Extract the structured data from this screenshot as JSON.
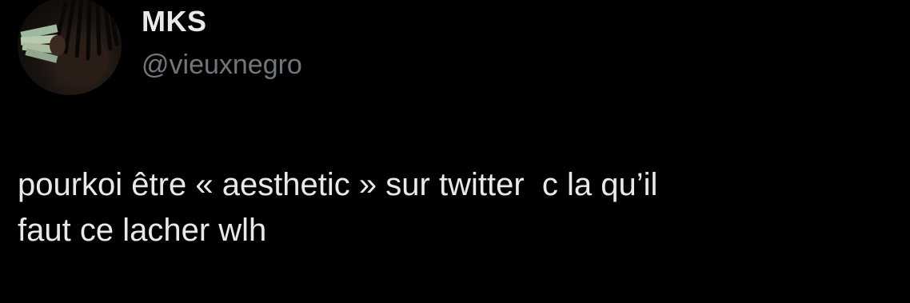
{
  "author": {
    "display_name": "MKS",
    "handle": "@vieuxnegro",
    "avatar_icon": "profile-photo"
  },
  "tweet": {
    "text_line_1": "pourkoi être « aesthetic » sur twitter  c la qu’il",
    "text_line_2": "faut ce lacher wlh"
  },
  "colors": {
    "background": "#000000",
    "primary_text": "#e7e9ea",
    "secondary_text": "#71767b"
  }
}
